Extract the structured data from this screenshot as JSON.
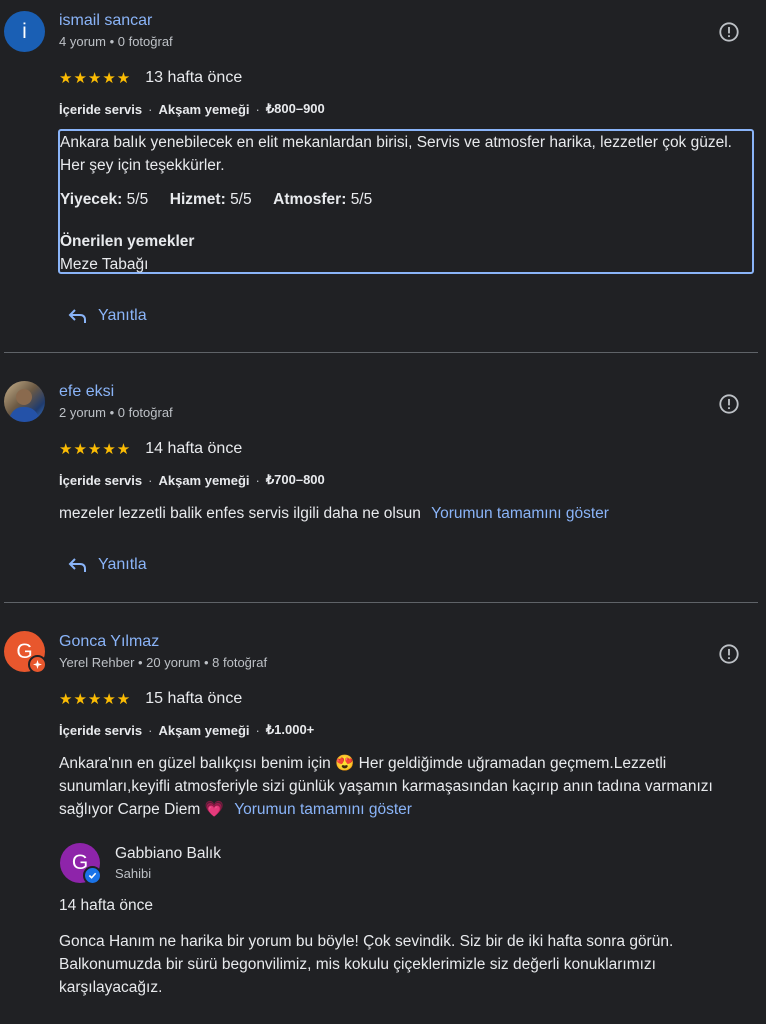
{
  "reviews": [
    {
      "author": "ismail sancar",
      "avatar_letter": "i",
      "meta": "4 yorum • 0 fotoğraf",
      "stars": "★★★★★",
      "time": "13 hafta önce",
      "service": "İçeride servis",
      "meal": "Akşam yemeği",
      "price": "₺800–900",
      "text": "Ankara balık yenebilecek en elit mekanlardan birisi, Servis ve atmosfer harika, lezzetler çok güzel. Her şey için teşekkürler.",
      "ratings": {
        "food_label": "Yiyecek:",
        "food_value": "5/5",
        "service_label": "Hizmet:",
        "service_value": "5/5",
        "atmosphere_label": "Atmosfer:",
        "atmosphere_value": "5/5"
      },
      "recommended_label": "Önerilen yemekler",
      "recommended_value": "Meze Tabağı",
      "reply_label": "Yanıtla"
    },
    {
      "author": "efe eksi",
      "meta": "2 yorum • 0 fotoğraf",
      "stars": "★★★★★",
      "time": "14 hafta önce",
      "service": "İçeride servis",
      "meal": "Akşam yemeği",
      "price": "₺700–800",
      "text": "mezeler lezzetli balik enfes servis ilgili daha ne olsun",
      "more_label": "Yorumun tamamını göster",
      "reply_label": "Yanıtla"
    },
    {
      "author": "Gonca Yılmaz",
      "avatar_letter": "G",
      "meta": "Yerel Rehber • 20 yorum • 8 fotoğraf",
      "stars": "★★★★★",
      "time": "15 hafta önce",
      "service": "İçeride servis",
      "meal": "Akşam yemeği",
      "price": "₺1.000+",
      "text": "Ankara'nın en güzel balıkçısı benim için 😍 Her geldiğimde uğramadan geçmem.Lezzetli sunumları,keyifli atmosferiyle sizi günlük yaşamın karmaşasından kaçırıp anın tadına varmanızı sağlıyor Carpe Diem 💗",
      "more_label": "Yorumun tamamını göster",
      "owner_reply": {
        "avatar_letter": "G",
        "name": "Gabbiano Balık",
        "role": "Sahibi",
        "time": "14 hafta önce",
        "text": "Gonca Hanım ne harika bir yorum bu böyle! Çok sevindik. Siz bir de iki hafta sonra görün. Balkonumuzda bir sürü begonvilimiz, mis kokulu çiçeklerimizle siz değerli konuklarımızı karşılayacağız."
      }
    }
  ],
  "colors": {
    "background": "#202124",
    "link": "#8ab4f8",
    "star": "#fbbc04",
    "divider": "#5f6368"
  }
}
